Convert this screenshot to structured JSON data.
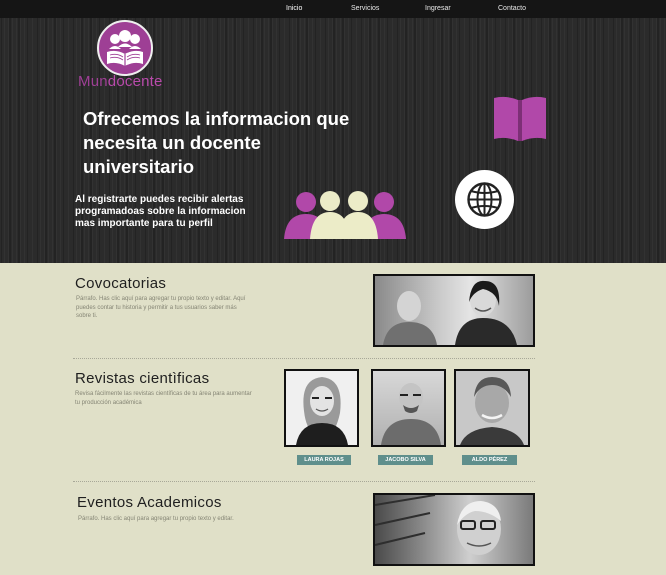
{
  "nav": {
    "items": [
      "Inicio",
      "Servicios",
      "Ingresar",
      "Contacto"
    ],
    "active": "Inicio"
  },
  "brand": {
    "name_part1": "Mun",
    "name_part2": "docente",
    "color": "#9e3f95"
  },
  "hero": {
    "headline": "Ofrecemos la informacion que necesita un docente universitario",
    "subtext": "Al  registrarte puedes recibir alertas programadoas sobre la informacion mas importante para tu perfil",
    "icons": [
      "book-icon",
      "people-icon",
      "globe-icon"
    ]
  },
  "sections": {
    "convocatorias": {
      "title": "Covocatorias",
      "text": "Párrafo. Has clic aquí para agregar tu propio texto y editar. Aquí puedes contar tu historia y permitir a tus usuarios saber más sobre ti."
    },
    "revistas": {
      "title": "Revistas cientìficas",
      "text": "Revisa fácilmente las revistas científicas de tu área para aumentar tu producción académica",
      "people": [
        "LAURA ROJAS",
        "JACOBO SILVA",
        "ALDO PÉREZ"
      ]
    },
    "eventos": {
      "title": "Eventos Academicos",
      "text": "Párrafo. Has clic aquí para agregar tu propio texto y editar."
    }
  },
  "colors": {
    "accent": "#9e3f95",
    "icon_purple": "#b148a9",
    "icon_cream": "#ececc8",
    "tag": "#5f8f8c",
    "content_bg": "#e0e0c8"
  }
}
